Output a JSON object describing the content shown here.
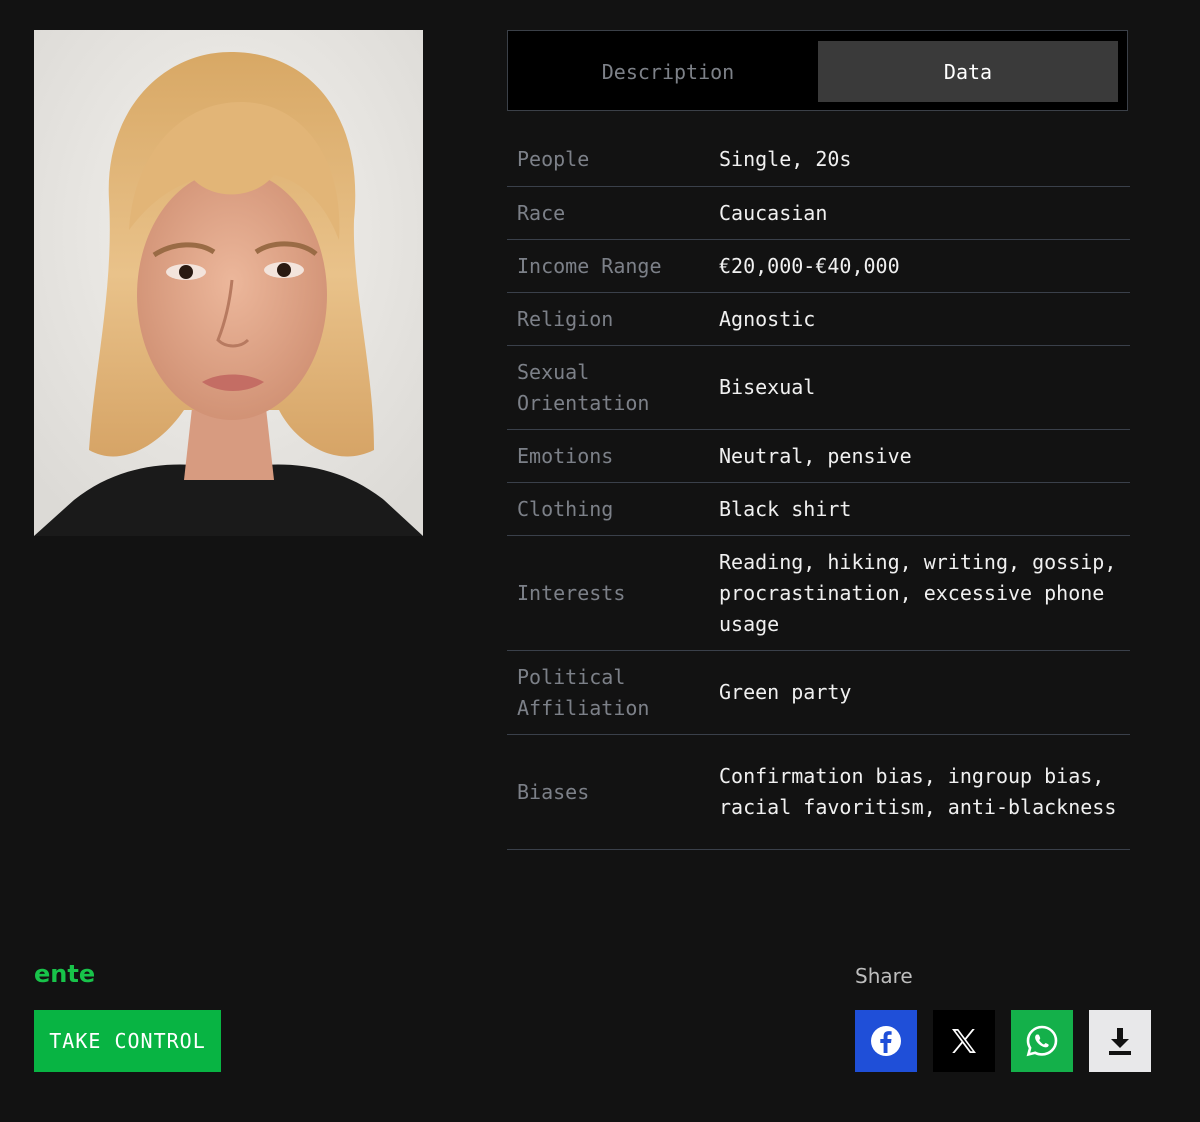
{
  "tabs": [
    {
      "label": "Description",
      "active": false
    },
    {
      "label": "Data",
      "active": true
    }
  ],
  "table": [
    {
      "label": "People",
      "value": "Single, 20s"
    },
    {
      "label": "Race",
      "value": "Caucasian"
    },
    {
      "label": "Income Range",
      "value": "€20,000-€40,000"
    },
    {
      "label": "Religion",
      "value": "Agnostic"
    },
    {
      "label": "Sexual Orientation",
      "value": "Bisexual"
    },
    {
      "label": "Emotions",
      "value": "Neutral, pensive"
    },
    {
      "label": "Clothing",
      "value": "Black shirt"
    },
    {
      "label": "Interests",
      "value": "Reading, hiking, writing, gossip, procrastination, excessive phone usage"
    },
    {
      "label": "Political Affiliation",
      "value": "Green party"
    },
    {
      "label": "Biases",
      "value": "Confirmation bias, ingroup bias, racial favoritism, anti-blackness"
    }
  ],
  "brand": {
    "name": "ente",
    "color": "#18c34a"
  },
  "cta": {
    "label": "TAKE CONTROL",
    "color": "#08b443"
  },
  "share": {
    "label": "Share",
    "buttons": [
      {
        "name": "facebook",
        "icon": "facebook-icon",
        "color": "#1f4fd8"
      },
      {
        "name": "x",
        "icon": "x-icon",
        "color": "#000000"
      },
      {
        "name": "whatsapp",
        "icon": "whatsapp-icon",
        "color": "#14b04a"
      },
      {
        "name": "download",
        "icon": "download-icon",
        "color": "#e8e8ea"
      }
    ]
  }
}
